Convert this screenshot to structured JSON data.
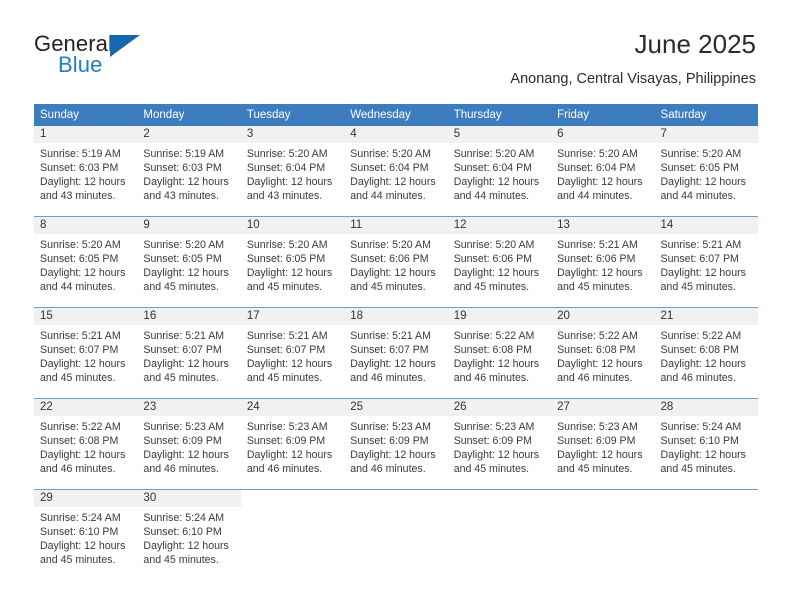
{
  "brand": {
    "word_one": "General",
    "word_two": "Blue",
    "accent_color": "#1f7fc6",
    "triangle_color": "#1567b0",
    "triangle_icon": "triangle-right-icon"
  },
  "header": {
    "title": "June 2025",
    "location": "Anonang, Central Visayas, Philippines"
  },
  "calendar": {
    "header_bg": "#3d7dbf",
    "header_text_color": "#ffffff",
    "daynum_band_bg": "#f1f1f1",
    "row_divider_color": "#6f9fd0",
    "weekdays": [
      "Sunday",
      "Monday",
      "Tuesday",
      "Wednesday",
      "Thursday",
      "Friday",
      "Saturday"
    ],
    "weeks": [
      [
        {
          "day": "1",
          "sunrise": "Sunrise: 5:19 AM",
          "sunset": "Sunset: 6:03 PM",
          "daylight": "Daylight: 12 hours and 43 minutes."
        },
        {
          "day": "2",
          "sunrise": "Sunrise: 5:19 AM",
          "sunset": "Sunset: 6:03 PM",
          "daylight": "Daylight: 12 hours and 43 minutes."
        },
        {
          "day": "3",
          "sunrise": "Sunrise: 5:20 AM",
          "sunset": "Sunset: 6:04 PM",
          "daylight": "Daylight: 12 hours and 43 minutes."
        },
        {
          "day": "4",
          "sunrise": "Sunrise: 5:20 AM",
          "sunset": "Sunset: 6:04 PM",
          "daylight": "Daylight: 12 hours and 44 minutes."
        },
        {
          "day": "5",
          "sunrise": "Sunrise: 5:20 AM",
          "sunset": "Sunset: 6:04 PM",
          "daylight": "Daylight: 12 hours and 44 minutes."
        },
        {
          "day": "6",
          "sunrise": "Sunrise: 5:20 AM",
          "sunset": "Sunset: 6:04 PM",
          "daylight": "Daylight: 12 hours and 44 minutes."
        },
        {
          "day": "7",
          "sunrise": "Sunrise: 5:20 AM",
          "sunset": "Sunset: 6:05 PM",
          "daylight": "Daylight: 12 hours and 44 minutes."
        }
      ],
      [
        {
          "day": "8",
          "sunrise": "Sunrise: 5:20 AM",
          "sunset": "Sunset: 6:05 PM",
          "daylight": "Daylight: 12 hours and 44 minutes."
        },
        {
          "day": "9",
          "sunrise": "Sunrise: 5:20 AM",
          "sunset": "Sunset: 6:05 PM",
          "daylight": "Daylight: 12 hours and 45 minutes."
        },
        {
          "day": "10",
          "sunrise": "Sunrise: 5:20 AM",
          "sunset": "Sunset: 6:05 PM",
          "daylight": "Daylight: 12 hours and 45 minutes."
        },
        {
          "day": "11",
          "sunrise": "Sunrise: 5:20 AM",
          "sunset": "Sunset: 6:06 PM",
          "daylight": "Daylight: 12 hours and 45 minutes."
        },
        {
          "day": "12",
          "sunrise": "Sunrise: 5:20 AM",
          "sunset": "Sunset: 6:06 PM",
          "daylight": "Daylight: 12 hours and 45 minutes."
        },
        {
          "day": "13",
          "sunrise": "Sunrise: 5:21 AM",
          "sunset": "Sunset: 6:06 PM",
          "daylight": "Daylight: 12 hours and 45 minutes."
        },
        {
          "day": "14",
          "sunrise": "Sunrise: 5:21 AM",
          "sunset": "Sunset: 6:07 PM",
          "daylight": "Daylight: 12 hours and 45 minutes."
        }
      ],
      [
        {
          "day": "15",
          "sunrise": "Sunrise: 5:21 AM",
          "sunset": "Sunset: 6:07 PM",
          "daylight": "Daylight: 12 hours and 45 minutes."
        },
        {
          "day": "16",
          "sunrise": "Sunrise: 5:21 AM",
          "sunset": "Sunset: 6:07 PM",
          "daylight": "Daylight: 12 hours and 45 minutes."
        },
        {
          "day": "17",
          "sunrise": "Sunrise: 5:21 AM",
          "sunset": "Sunset: 6:07 PM",
          "daylight": "Daylight: 12 hours and 45 minutes."
        },
        {
          "day": "18",
          "sunrise": "Sunrise: 5:21 AM",
          "sunset": "Sunset: 6:07 PM",
          "daylight": "Daylight: 12 hours and 46 minutes."
        },
        {
          "day": "19",
          "sunrise": "Sunrise: 5:22 AM",
          "sunset": "Sunset: 6:08 PM",
          "daylight": "Daylight: 12 hours and 46 minutes."
        },
        {
          "day": "20",
          "sunrise": "Sunrise: 5:22 AM",
          "sunset": "Sunset: 6:08 PM",
          "daylight": "Daylight: 12 hours and 46 minutes."
        },
        {
          "day": "21",
          "sunrise": "Sunrise: 5:22 AM",
          "sunset": "Sunset: 6:08 PM",
          "daylight": "Daylight: 12 hours and 46 minutes."
        }
      ],
      [
        {
          "day": "22",
          "sunrise": "Sunrise: 5:22 AM",
          "sunset": "Sunset: 6:08 PM",
          "daylight": "Daylight: 12 hours and 46 minutes."
        },
        {
          "day": "23",
          "sunrise": "Sunrise: 5:23 AM",
          "sunset": "Sunset: 6:09 PM",
          "daylight": "Daylight: 12 hours and 46 minutes."
        },
        {
          "day": "24",
          "sunrise": "Sunrise: 5:23 AM",
          "sunset": "Sunset: 6:09 PM",
          "daylight": "Daylight: 12 hours and 46 minutes."
        },
        {
          "day": "25",
          "sunrise": "Sunrise: 5:23 AM",
          "sunset": "Sunset: 6:09 PM",
          "daylight": "Daylight: 12 hours and 46 minutes."
        },
        {
          "day": "26",
          "sunrise": "Sunrise: 5:23 AM",
          "sunset": "Sunset: 6:09 PM",
          "daylight": "Daylight: 12 hours and 45 minutes."
        },
        {
          "day": "27",
          "sunrise": "Sunrise: 5:23 AM",
          "sunset": "Sunset: 6:09 PM",
          "daylight": "Daylight: 12 hours and 45 minutes."
        },
        {
          "day": "28",
          "sunrise": "Sunrise: 5:24 AM",
          "sunset": "Sunset: 6:10 PM",
          "daylight": "Daylight: 12 hours and 45 minutes."
        }
      ],
      [
        {
          "day": "29",
          "sunrise": "Sunrise: 5:24 AM",
          "sunset": "Sunset: 6:10 PM",
          "daylight": "Daylight: 12 hours and 45 minutes."
        },
        {
          "day": "30",
          "sunrise": "Sunrise: 5:24 AM",
          "sunset": "Sunset: 6:10 PM",
          "daylight": "Daylight: 12 hours and 45 minutes."
        },
        null,
        null,
        null,
        null,
        null
      ]
    ]
  }
}
